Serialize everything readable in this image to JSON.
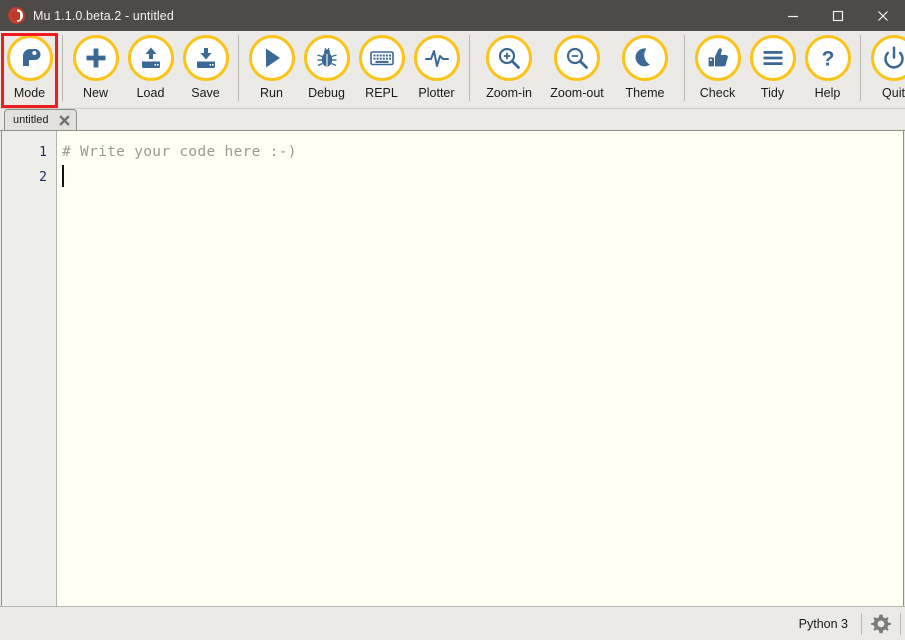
{
  "window": {
    "title": "Mu 1.1.0.beta.2 - untitled",
    "logo_icon": "mu-logo-icon",
    "controls": {
      "minimize": "minimize-icon",
      "maximize": "maximize-icon",
      "close": "close-icon"
    }
  },
  "toolbar": {
    "groups": [
      {
        "name": "mode-group",
        "buttons": [
          {
            "id": "mode",
            "label": "Mode",
            "icon": "mu-snake-icon",
            "highlighted": true
          }
        ]
      },
      {
        "name": "file-group",
        "buttons": [
          {
            "id": "new",
            "label": "New",
            "icon": "plus-icon",
            "highlighted": false
          },
          {
            "id": "load",
            "label": "Load",
            "icon": "upload-icon",
            "highlighted": false
          },
          {
            "id": "save",
            "label": "Save",
            "icon": "download-icon",
            "highlighted": false
          }
        ]
      },
      {
        "name": "run-group",
        "buttons": [
          {
            "id": "run",
            "label": "Run",
            "icon": "play-icon",
            "highlighted": false
          },
          {
            "id": "debug",
            "label": "Debug",
            "icon": "bug-icon",
            "highlighted": false
          },
          {
            "id": "repl",
            "label": "REPL",
            "icon": "keyboard-icon",
            "highlighted": false
          },
          {
            "id": "plotter",
            "label": "Plotter",
            "icon": "waveform-icon",
            "highlighted": false
          }
        ]
      },
      {
        "name": "view-group",
        "buttons": [
          {
            "id": "zoom-in",
            "label": "Zoom-in",
            "icon": "magnifier-plus-icon",
            "highlighted": false
          },
          {
            "id": "zoom-out",
            "label": "Zoom-out",
            "icon": "magnifier-minus-icon",
            "highlighted": false
          },
          {
            "id": "theme",
            "label": "Theme",
            "icon": "moon-icon",
            "highlighted": false
          }
        ]
      },
      {
        "name": "tools-group",
        "buttons": [
          {
            "id": "check",
            "label": "Check",
            "icon": "thumbs-up-icon",
            "highlighted": false
          },
          {
            "id": "tidy",
            "label": "Tidy",
            "icon": "lines-icon",
            "highlighted": false
          },
          {
            "id": "help",
            "label": "Help",
            "icon": "question-mark-icon",
            "highlighted": false
          }
        ]
      },
      {
        "name": "quit-group",
        "buttons": [
          {
            "id": "quit",
            "label": "Quit",
            "icon": "power-icon",
            "highlighted": false
          }
        ]
      }
    ],
    "accent_color": "#fcc419",
    "icon_color": "#3b6894",
    "highlight_color": "#ee1c1c"
  },
  "tabs": [
    {
      "label": "untitled",
      "close_icon": "close-tab-icon",
      "active": true
    }
  ],
  "editor": {
    "line_numbers": [
      "1",
      "2"
    ],
    "lines": [
      "# Write your code here :-)",
      ""
    ],
    "background_color": "#fffff3",
    "gutter_color": "#ededea",
    "comment_color": "#9a9a95"
  },
  "statusbar": {
    "mode_label": "Python 3",
    "settings_icon": "gear-icon"
  }
}
